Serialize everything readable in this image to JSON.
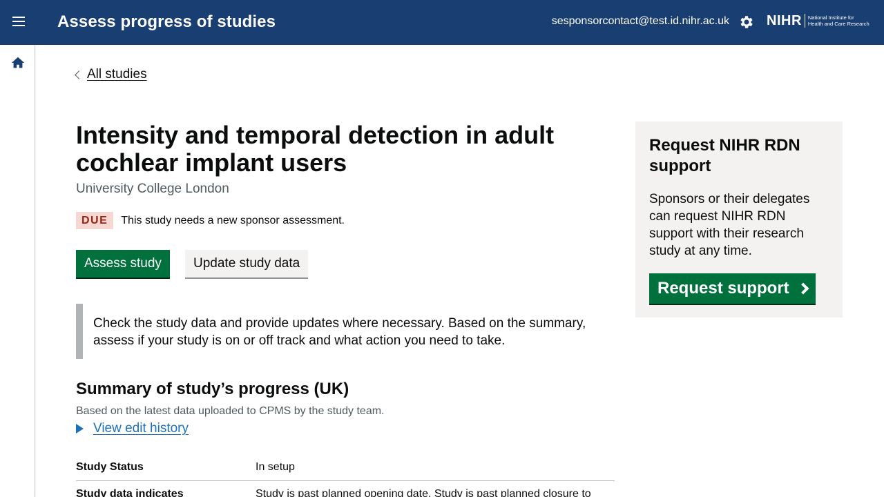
{
  "header": {
    "title": "Assess progress of studies",
    "user_email": "sesponsorcontact@test.id.nihr.ac.uk",
    "logo_main": "NIHR",
    "logo_sub_line1": "National Institute for",
    "logo_sub_line2": "Health and Care Research",
    "icons": {
      "menu": "menu-icon",
      "settings": "gear-icon",
      "home": "home-icon"
    },
    "color": "#193e72"
  },
  "breadcrumb": {
    "back_label": "All studies"
  },
  "study": {
    "title": "Intensity and temporal detection in adult cochlear implant users",
    "organisation": "University College London",
    "status_tag": "DUE",
    "status_message": "This study needs a new sponsor assessment."
  },
  "actions": {
    "assess_label": "Assess study",
    "update_label": "Update study data"
  },
  "inset_text": "Check the study data and provide updates where necessary. Based on the summary, assess if your study is on or off track and what action you need to take.",
  "summary": {
    "heading": "Summary of study’s progress (UK)",
    "subheading": "Based on the latest data uploaded to CPMS by the study team.",
    "history_link": "View edit history",
    "rows": [
      {
        "key": "Study Status",
        "value": "In setup"
      },
      {
        "key": "Study data indicates",
        "value": "Study is past planned opening date. Study is past planned closure to"
      }
    ]
  },
  "support_panel": {
    "heading": "Request NIHR RDN support",
    "body": "Sponsors or their delegates can request NIHR RDN support with their research study at any time.",
    "button_label": "Request support"
  },
  "colors": {
    "primary_green": "#00703c",
    "link_blue": "#1d70b8",
    "due_bg": "#f6d7d2",
    "due_text": "#942514"
  }
}
